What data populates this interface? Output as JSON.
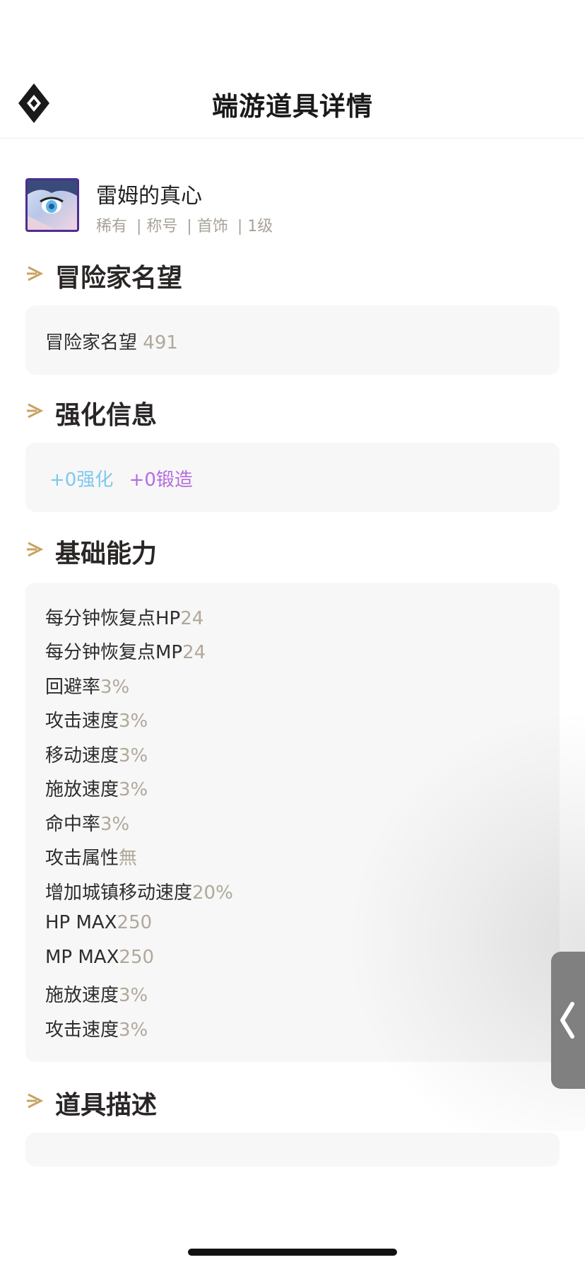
{
  "header": {
    "title": "端游道具详情",
    "logo_icon": "diamond-logo-icon"
  },
  "item": {
    "name": "雷姆的真心",
    "meta": [
      "稀有",
      "| 称号",
      "| 首饰",
      "| 1级"
    ]
  },
  "sections": {
    "reputation": {
      "title": "冒险家名望",
      "label": "冒险家名望",
      "value": "491"
    },
    "enhance": {
      "title": "强化信息",
      "enhance_label": "+0强化",
      "forge_label": "+0锻造"
    },
    "basic": {
      "title": "基础能力",
      "stats": [
        {
          "label": "每分钟恢复点HP",
          "value": "24"
        },
        {
          "label": "每分钟恢复点MP",
          "value": "24"
        },
        {
          "label": "回避率",
          "value": "3%"
        },
        {
          "label": "攻击速度",
          "value": "3%"
        },
        {
          "label": "移动速度",
          "value": "3%"
        },
        {
          "label": "施放速度",
          "value": "3%"
        },
        {
          "label": "命中率",
          "value": "3%"
        },
        {
          "label": "攻击属性",
          "value": "無"
        },
        {
          "label": "增加城镇移动速度",
          "value": "20%"
        },
        {
          "label": "HP MAX",
          "value": "250"
        },
        {
          "label": "MP MAX",
          "value": "250"
        },
        {
          "label": "施放速度",
          "value": "3%"
        },
        {
          "label": "攻击速度",
          "value": "3%"
        }
      ]
    },
    "description": {
      "title": "道具描述",
      "text": ""
    }
  },
  "colors": {
    "accent_gold": "#c9a264",
    "value_gray": "#b0a89a",
    "enhance_blue": "#7fc8ee",
    "forge_purple": "#b56be0",
    "card_bg": "#f7f7f7"
  },
  "side_tab_icon": "chevron-left-icon"
}
